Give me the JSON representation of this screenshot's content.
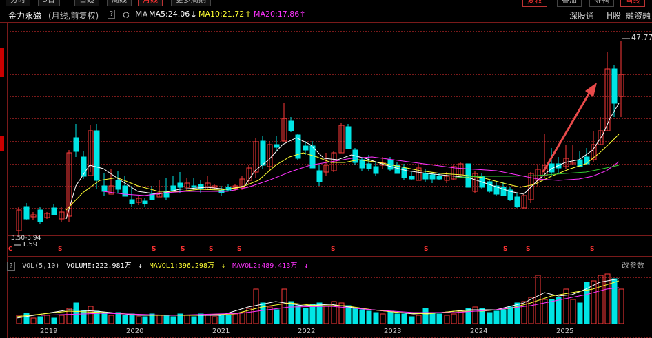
{
  "top_tabs": [
    "分时",
    "5日",
    "日线",
    "周线",
    "月线",
    "更多周期"
  ],
  "top_right": [
    "复权",
    "叠加",
    "寻鸭",
    "画线"
  ],
  "header": {
    "stock_name": "金力永磁",
    "period": "(月线,前复权)",
    "help": "?",
    "ma_label": "MA",
    "ma5": "MA5:24.06",
    "ma5_arrow": "↓",
    "ma10": "MA10:21.72",
    "ma10_arrow": "↑",
    "ma20": "MA20:17.86",
    "ma20_arrow": "↑",
    "right_links": [
      "深股通",
      "H股",
      "融资融"
    ]
  },
  "price_labels": {
    "high": "47.77",
    "low": "1.59",
    "range": "3.50-3.94"
  },
  "vol_header": {
    "help": "?",
    "name": "VOL(5,10)",
    "volume": "VOLUME:222.981万",
    "volume_arrow": "↓",
    "mavol1": "MAVOL1:396.298万",
    "mavol1_arrow": "↓",
    "mavol2": "MAVOL2:489.413万",
    "mavol2_arrow": "↓",
    "change_params": "改参数"
  },
  "years": [
    "2019",
    "2020",
    "2021",
    "2022",
    "2023",
    "2024",
    "2025"
  ],
  "marker_s": "S",
  "colors": {
    "up": "#ff3a3a",
    "down": "#00e5e5",
    "ma5": "#ffffff",
    "ma10": "#ffff33",
    "ma20": "#ff33ff",
    "ma30": "#33cc33",
    "grid": "#7a1a1a"
  }
}
